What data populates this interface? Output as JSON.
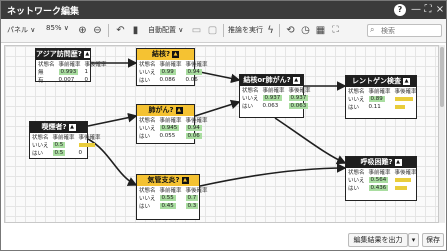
{
  "window": {
    "title": "ネットワーク編集",
    "help": "?",
    "minimize": "—",
    "maximize": "⛶",
    "close": "×"
  },
  "toolbar": {
    "panel_label": "パネル ∨",
    "zoom": "85% ∨",
    "auto_layout": "自動配置 ∨",
    "run_infer": "推論を実行",
    "search_placeholder": "検索"
  },
  "nodes": {
    "asia": {
      "title": "アジア訪問歴?",
      "cols": [
        "状態名",
        "事前確率",
        "事後確率"
      ],
      "rows": [
        {
          "name": "無",
          "prior": "0.993",
          "post": "1"
        },
        {
          "name": "有",
          "prior": "0.007",
          "post": "0"
        }
      ]
    },
    "kekkaku": {
      "title": "結核?",
      "cols": [
        "状態名",
        "事前確率",
        "事後確率"
      ],
      "rows": [
        {
          "name": "いいえ",
          "prior": "0.99",
          "post": "0.94"
        },
        {
          "name": "はい",
          "prior": "0.086",
          "post": "0.06"
        }
      ]
    },
    "kitsuen": {
      "title": "喫煙者?",
      "cols": [
        "状態名",
        "事前確率",
        "事後確率"
      ],
      "rows": [
        {
          "name": "いいえ",
          "prior": "0.5",
          "post": "1"
        },
        {
          "name": "はい",
          "prior": "0.5",
          "post": "0"
        }
      ]
    },
    "haigan": {
      "title": "肺がん?",
      "cols": [
        "状態名",
        "事前確率",
        "事後確率"
      ],
      "rows": [
        {
          "name": "いいえ",
          "prior": "0.945",
          "post": "0.94"
        },
        {
          "name": "はい",
          "prior": "0.055",
          "post": "0.06"
        }
      ]
    },
    "kikanshien": {
      "title": "気管支炎?",
      "cols": [
        "状態名",
        "事前確率",
        "事後確率"
      ],
      "rows": [
        {
          "name": "いいえ",
          "prior": "0.55",
          "post": "0.7"
        },
        {
          "name": "はい",
          "prior": "0.45",
          "post": "0.3"
        }
      ]
    },
    "kekkaku_or_gan": {
      "title": "結核or肺がん?",
      "cols": [
        "状態名",
        "事前確率",
        "事後確率"
      ],
      "rows": [
        {
          "name": "いいえ",
          "prior": "0.937",
          "post": "0.937"
        },
        {
          "name": "はい",
          "prior": "0.063",
          "post": "0.063"
        }
      ]
    },
    "xray": {
      "title": "レントゲン検査",
      "cols": [
        "状態名",
        "事前確率",
        "事後確率"
      ],
      "rows": [
        {
          "name": "いいえ",
          "prior": "0.89",
          "post": "0.89"
        },
        {
          "name": "はい",
          "prior": "0.11",
          "post": "0.11"
        }
      ]
    },
    "kokyu": {
      "title": "呼吸困難?",
      "cols": [
        "状態名",
        "事前確率",
        "事後確率"
      ],
      "rows": [
        {
          "name": "いいえ",
          "prior": "0.564",
          "post": "0.64"
        },
        {
          "name": "はい",
          "prior": "0.436",
          "post": "0.36"
        }
      ]
    }
  },
  "footer": {
    "export_label": "編集結果を出力",
    "export_dropdown": "▾",
    "save_label": "保存"
  }
}
